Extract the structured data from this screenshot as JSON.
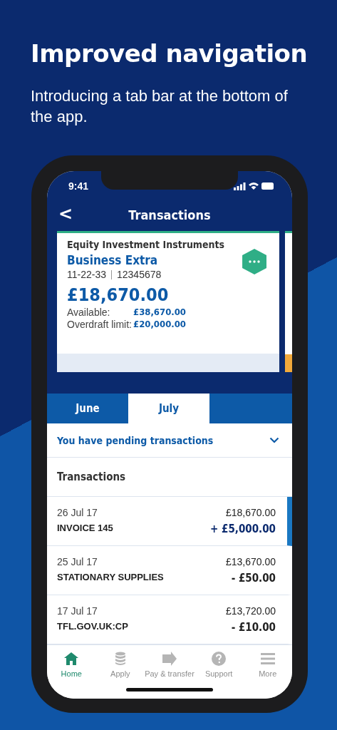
{
  "headline": "Improved navigation",
  "subtitle": "Introducing a tab bar at the bottom of the app.",
  "status_bar": {
    "time": "9:41"
  },
  "header": {
    "back": "<",
    "title": "Transactions"
  },
  "account_card": {
    "company": "Equity Investment Instruments",
    "name": "Business Extra",
    "sort_code": "11-22-33",
    "account_number": "12345678",
    "balance": "£18,670.00",
    "available_label": "Available:",
    "available": "£38,670.00",
    "overdraft_label": "Overdraft limit:",
    "overdraft": "£20,000.00"
  },
  "month_tabs": [
    {
      "label": "June",
      "selected": false
    },
    {
      "label": "July",
      "selected": true
    }
  ],
  "pending": {
    "label": "You have pending transactions",
    "expanded": false
  },
  "section_title": "Transactions",
  "transactions": [
    {
      "date": "26 Jul 17",
      "description": "INVOICE 145",
      "balance": "£18,670.00",
      "amount": "+ £5,000.00",
      "kind": "credit",
      "selected": true
    },
    {
      "date": "25 Jul 17",
      "description": "STATIONARY SUPPLIES",
      "balance": "£13,670.00",
      "amount": "- £50.00",
      "kind": "debit",
      "selected": false
    },
    {
      "date": "17 Jul 17",
      "description": "TFL.GOV.UK:CP",
      "balance": "£13,720.00",
      "amount": "- £10.00",
      "kind": "debit",
      "selected": false
    }
  ],
  "tab_bar": [
    {
      "label": "Home",
      "kind": "home",
      "selected": true
    },
    {
      "label": "Apply",
      "kind": "apply",
      "selected": false
    },
    {
      "label": "Pay & transfer",
      "kind": "pay",
      "selected": false
    },
    {
      "label": "Support",
      "kind": "support",
      "selected": false
    },
    {
      "label": "More",
      "kind": "more",
      "selected": false
    }
  ]
}
